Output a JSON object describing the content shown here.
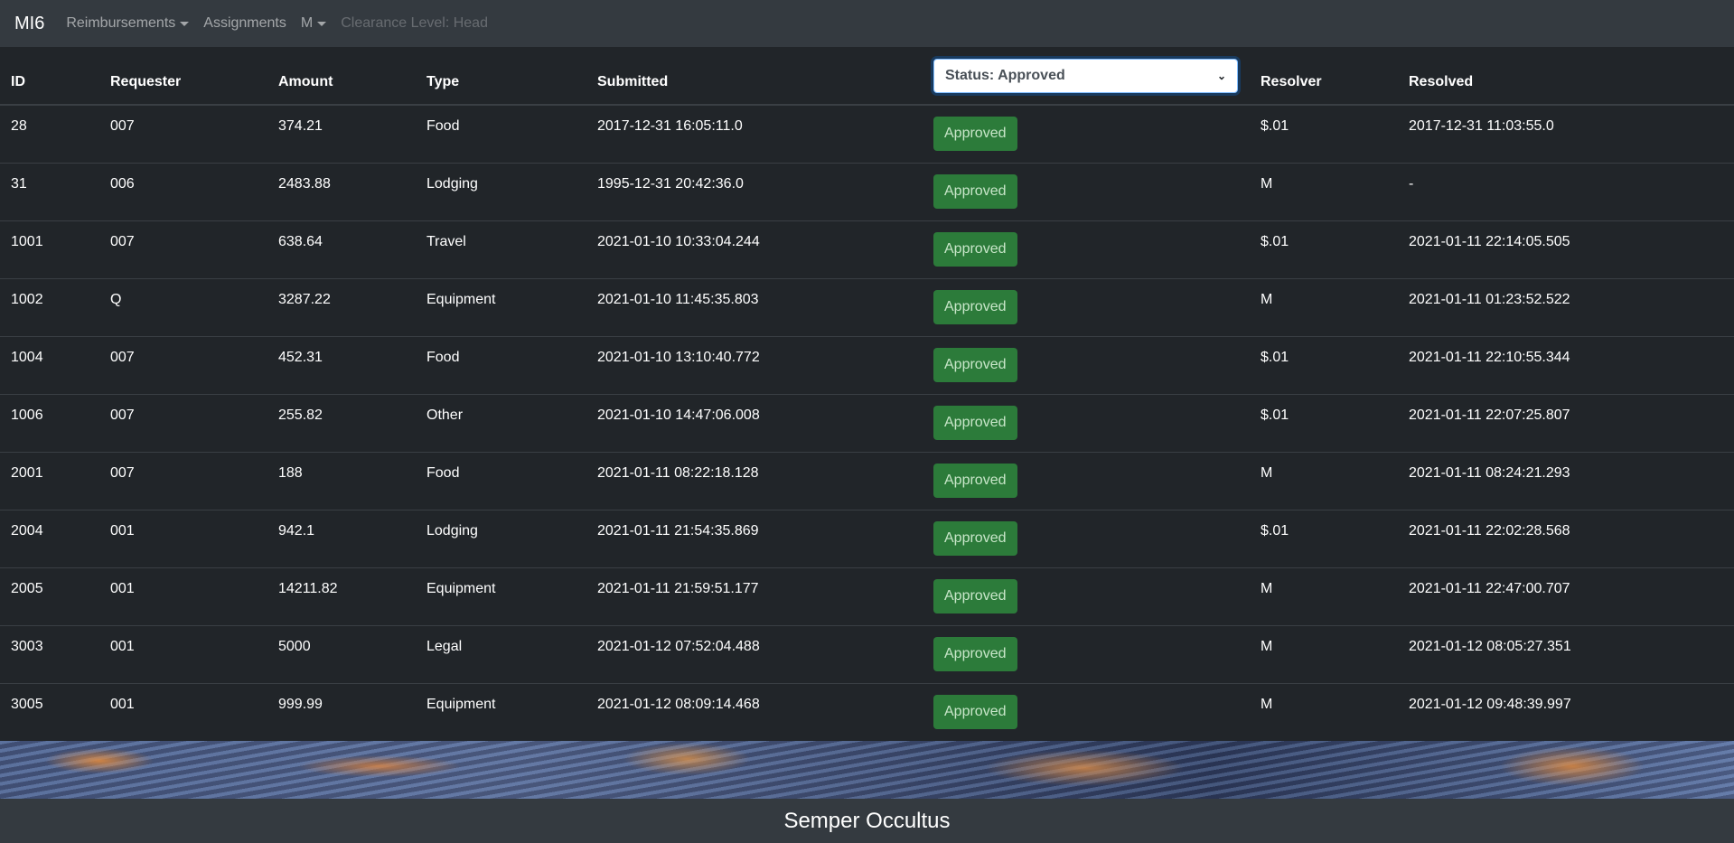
{
  "navbar": {
    "brand": "MI6",
    "reimbursements": "Reimbursements",
    "assignments": "Assignments",
    "user": "M",
    "clearance": "Clearance Level: Head"
  },
  "table": {
    "headers": {
      "id": "ID",
      "requester": "Requester",
      "amount": "Amount",
      "type": "Type",
      "submitted": "Submitted",
      "status_filter": "Status: Approved",
      "resolver": "Resolver",
      "resolved": "Resolved"
    },
    "rows": [
      {
        "id": "28",
        "requester": "007",
        "amount": "374.21",
        "type": "Food",
        "submitted": "2017-12-31 16:05:11.0",
        "status": "Approved",
        "resolver": "$.01",
        "resolved": "2017-12-31 11:03:55.0"
      },
      {
        "id": "31",
        "requester": "006",
        "amount": "2483.88",
        "type": "Lodging",
        "submitted": "1995-12-31 20:42:36.0",
        "status": "Approved",
        "resolver": "M",
        "resolved": "-"
      },
      {
        "id": "1001",
        "requester": "007",
        "amount": "638.64",
        "type": "Travel",
        "submitted": "2021-01-10 10:33:04.244",
        "status": "Approved",
        "resolver": "$.01",
        "resolved": "2021-01-11 22:14:05.505"
      },
      {
        "id": "1002",
        "requester": "Q",
        "amount": "3287.22",
        "type": "Equipment",
        "submitted": "2021-01-10 11:45:35.803",
        "status": "Approved",
        "resolver": "M",
        "resolved": "2021-01-11 01:23:52.522"
      },
      {
        "id": "1004",
        "requester": "007",
        "amount": "452.31",
        "type": "Food",
        "submitted": "2021-01-10 13:10:40.772",
        "status": "Approved",
        "resolver": "$.01",
        "resolved": "2021-01-11 22:10:55.344"
      },
      {
        "id": "1006",
        "requester": "007",
        "amount": "255.82",
        "type": "Other",
        "submitted": "2021-01-10 14:47:06.008",
        "status": "Approved",
        "resolver": "$.01",
        "resolved": "2021-01-11 22:07:25.807"
      },
      {
        "id": "2001",
        "requester": "007",
        "amount": "188",
        "type": "Food",
        "submitted": "2021-01-11 08:22:18.128",
        "status": "Approved",
        "resolver": "M",
        "resolved": "2021-01-11 08:24:21.293"
      },
      {
        "id": "2004",
        "requester": "001",
        "amount": "942.1",
        "type": "Lodging",
        "submitted": "2021-01-11 21:54:35.869",
        "status": "Approved",
        "resolver": "$.01",
        "resolved": "2021-01-11 22:02:28.568"
      },
      {
        "id": "2005",
        "requester": "001",
        "amount": "14211.82",
        "type": "Equipment",
        "submitted": "2021-01-11 21:59:51.177",
        "status": "Approved",
        "resolver": "M",
        "resolved": "2021-01-11 22:47:00.707"
      },
      {
        "id": "3003",
        "requester": "001",
        "amount": "5000",
        "type": "Legal",
        "submitted": "2021-01-12 07:52:04.488",
        "status": "Approved",
        "resolver": "M",
        "resolved": "2021-01-12 08:05:27.351"
      },
      {
        "id": "3005",
        "requester": "001",
        "amount": "999.99",
        "type": "Equipment",
        "submitted": "2021-01-12 08:09:14.468",
        "status": "Approved",
        "resolver": "M",
        "resolved": "2021-01-12 09:48:39.997"
      }
    ]
  },
  "footer": {
    "motto": "Semper Occultus"
  },
  "colors": {
    "navbar_bg": "#343a40",
    "page_bg": "#212529",
    "approved_badge": "#2c7b3a"
  }
}
